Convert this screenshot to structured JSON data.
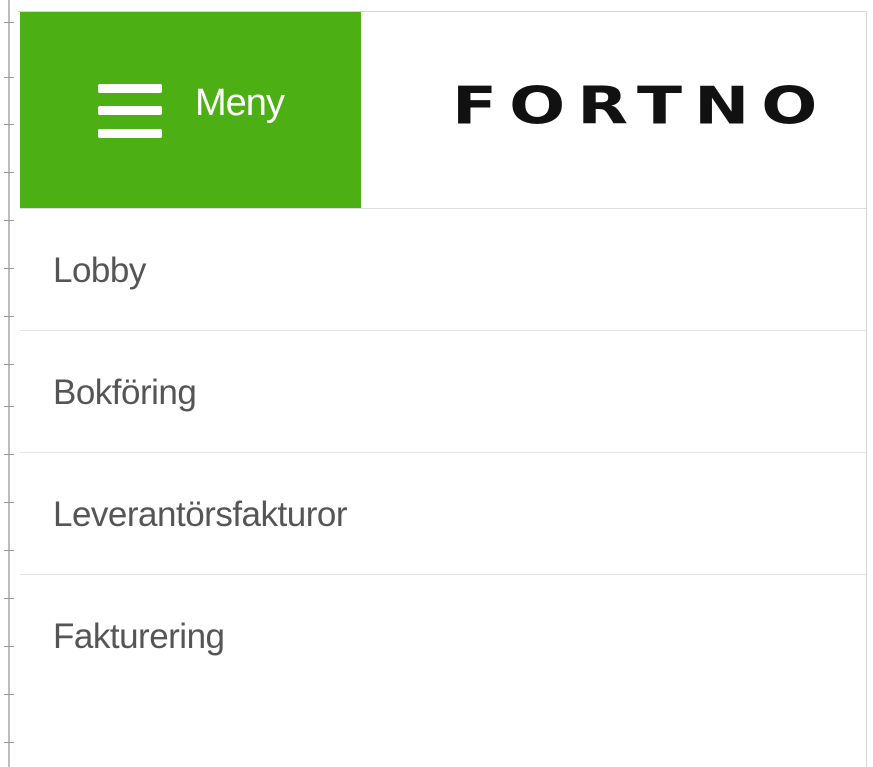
{
  "header": {
    "menu_label": "Meny",
    "logo_text": "FORTNO",
    "menu_color": "#4caf14"
  },
  "nav": {
    "items": [
      {
        "label": "Lobby"
      },
      {
        "label": "Bokföring"
      },
      {
        "label": "Leverantörsfakturor"
      },
      {
        "label": "Fakturering"
      }
    ]
  }
}
